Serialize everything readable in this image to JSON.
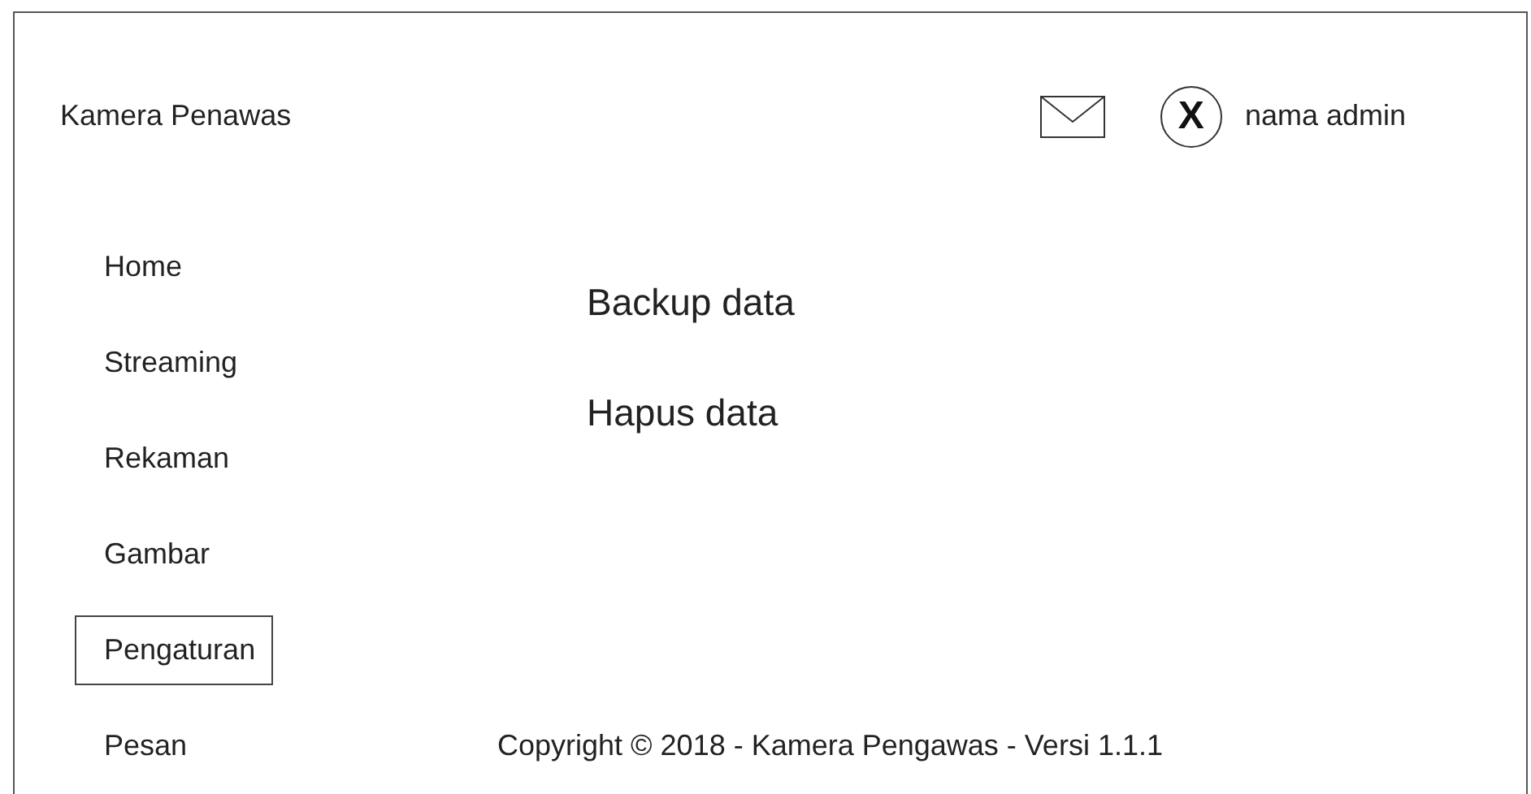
{
  "header": {
    "title": "Kamera Penawas",
    "user": "nama admin",
    "logout_symbol": "X"
  },
  "sidebar": {
    "items": [
      {
        "label": "Home",
        "selected": false
      },
      {
        "label": "Streaming",
        "selected": false
      },
      {
        "label": "Rekaman",
        "selected": false
      },
      {
        "label": "Gambar",
        "selected": false
      },
      {
        "label": "Pengaturan",
        "selected": true
      },
      {
        "label": "Pesan",
        "selected": false
      }
    ]
  },
  "content": {
    "actions": [
      "Backup data",
      "Hapus data"
    ]
  },
  "footer": "Copyright © 2018 - Kamera Pengawas - Versi 1.1.1"
}
